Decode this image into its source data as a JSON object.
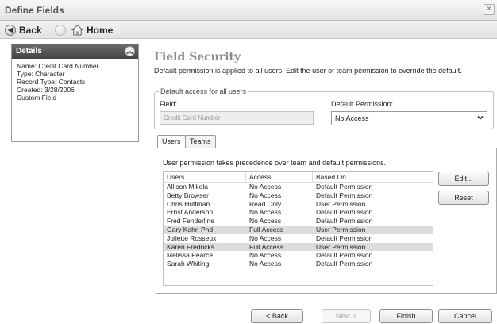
{
  "window": {
    "title": "Define Fields"
  },
  "nav": {
    "back_label": "Back",
    "home_label": "Home"
  },
  "details": {
    "header": "Details",
    "lines": [
      "Name: Credit Card Number",
      "Type: Character",
      "Record Type: Contacts",
      "Created: 3/28/2006",
      "Custom Field"
    ]
  },
  "main": {
    "title": "Field Security",
    "description": "Default permission is applied to all users. Edit the user or team permission to override the default."
  },
  "default_access": {
    "legend": "Default access for all users",
    "field_label": "Field:",
    "field_value": "Credit Card Number",
    "permission_label": "Default Permission:",
    "permission_value": "No Access"
  },
  "tabs": [
    {
      "label": "Users"
    },
    {
      "label": "Teams"
    }
  ],
  "users_panel": {
    "note": "User permission takes precedence over team and default permissions.",
    "columns": [
      "Users",
      "Access",
      "Based On"
    ],
    "rows": [
      {
        "user": "Allison Mikola",
        "access": "No Access",
        "based_on": "Default Permission"
      },
      {
        "user": "Betty Browser",
        "access": "No Access",
        "based_on": "Default Permission"
      },
      {
        "user": "Chris Huffman",
        "access": "Read Only",
        "based_on": "User Permission"
      },
      {
        "user": "Ernst Anderson",
        "access": "No Access",
        "based_on": "Default Permission"
      },
      {
        "user": "Fred Fenderline",
        "access": "No Access",
        "based_on": "Default Permission"
      },
      {
        "user": "Gary Kahn Phd",
        "access": "Full Access",
        "based_on": "User Permission"
      },
      {
        "user": "Juliette Rosseux",
        "access": "No Access",
        "based_on": "Default Permission"
      },
      {
        "user": "Karen Fredricks",
        "access": "Full Access",
        "based_on": "User Permission"
      },
      {
        "user": "Melissa Pearce",
        "access": "No Access",
        "based_on": "Default Permission"
      },
      {
        "user": "Sarah Whiting",
        "access": "No Access",
        "based_on": "Default Permission"
      }
    ],
    "edit_label": "Edit...",
    "reset_label": "Reset"
  },
  "footer": {
    "back_label": "< Back",
    "next_label": "Next >",
    "finish_label": "Finish",
    "cancel_label": "Cancel"
  },
  "colors": {
    "details_header": "#555555",
    "highlight_row": "#dcdcdc",
    "title_gray": "#8c8c8c"
  }
}
